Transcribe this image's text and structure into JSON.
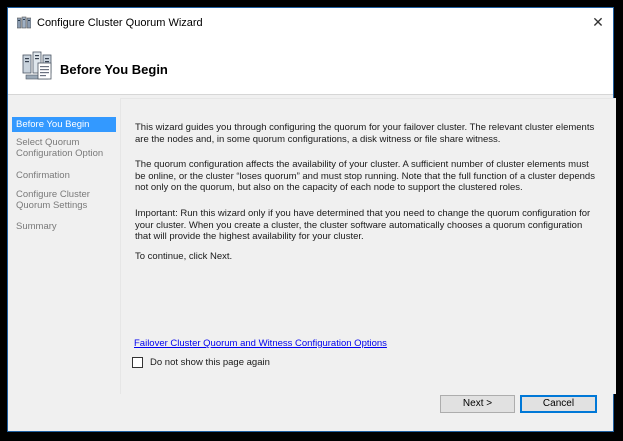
{
  "window": {
    "title": "Configure Cluster Quorum Wizard",
    "close_glyph": "✕"
  },
  "header": {
    "title": "Before You Begin"
  },
  "steps": [
    {
      "label": "Before You Begin",
      "active": true
    },
    {
      "label": "Select Quorum Configuration Option",
      "active": false
    },
    {
      "label": "Confirmation",
      "active": false
    },
    {
      "label": "Configure Cluster Quorum Settings",
      "active": false
    },
    {
      "label": "Summary",
      "active": false
    }
  ],
  "content": {
    "para1": "This wizard guides you through configuring the quorum for your failover cluster. The relevant cluster elements are the nodes and, in some quorum configurations, a disk witness or file share witness.",
    "para2": "The quorum configuration affects the availability of your cluster. A sufficient number of cluster elements must be online, or the cluster “loses quorum” and must stop running. Note that the full function of a cluster depends not only on the quorum, but also on the capacity of each node to support the clustered roles.",
    "para3": "Important: Run this wizard only if you have determined that you need to change the quorum configuration for your cluster. When you create a cluster, the cluster software automatically chooses a quorum configuration that will provide the highest availability for your cluster.",
    "para4": "To continue, click Next.",
    "link": "Failover Cluster Quorum and Witness Configuration Options",
    "checkbox_label": "Do not show this page again",
    "checkbox_checked": false
  },
  "buttons": {
    "next": "Next >",
    "cancel": "Cancel"
  },
  "colors": {
    "accent": "#3399ff",
    "window_border": "#1f5fa0",
    "link": "#0000ee"
  }
}
